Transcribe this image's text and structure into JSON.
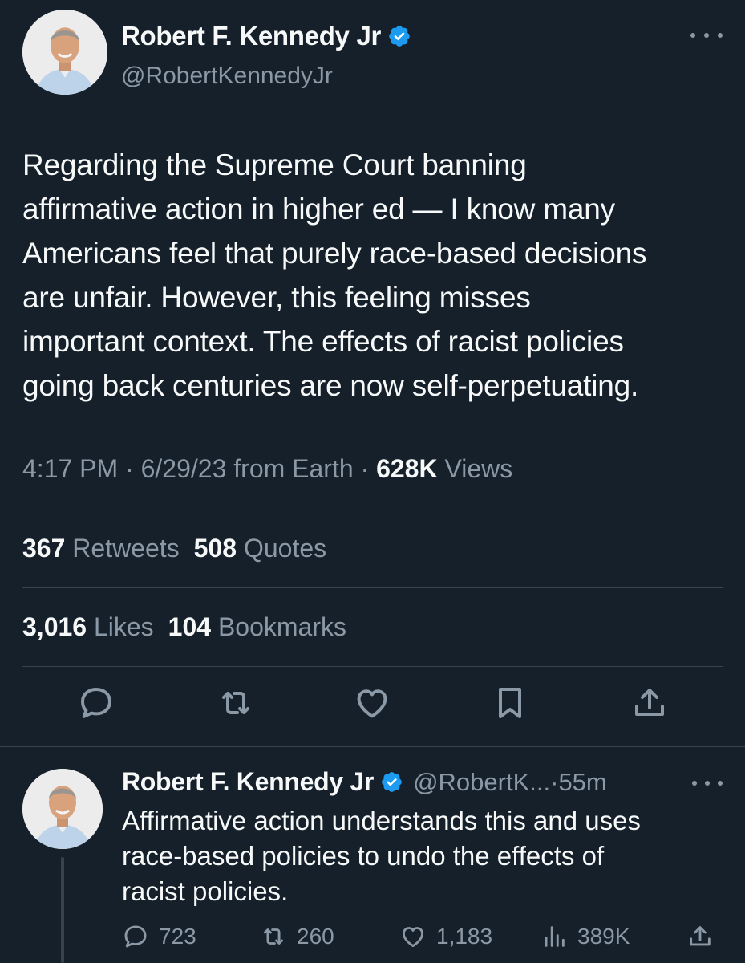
{
  "main_tweet": {
    "author": {
      "name": "Robert F. Kennedy Jr",
      "handle": "@RobertKennedyJr",
      "verified": true
    },
    "text_lines": [
      "Regarding the Supreme Court banning",
      "affirmative action in higher ed — I know many",
      "Americans feel that purely race-based decisions",
      "are unfair. However, this feeling misses",
      "important context. The effects of racist policies",
      "going back centuries are now self-perpetuating."
    ],
    "meta": {
      "time": "4:17 PM",
      "sep1": "·",
      "date_source": "6/29/23 from Earth",
      "sep2": "·",
      "views_count": "628K",
      "views_label": "Views"
    },
    "stats": {
      "retweets_count": "367",
      "retweets_label": "Retweets",
      "quotes_count": "508",
      "quotes_label": "Quotes",
      "likes_count": "3,016",
      "likes_label": "Likes",
      "bookmarks_count": "104",
      "bookmarks_label": "Bookmarks"
    },
    "actions": [
      "reply-icon",
      "retweet-icon",
      "like-icon",
      "bookmark-icon",
      "share-icon"
    ]
  },
  "reply_tweet": {
    "author": {
      "name": "Robert F. Kennedy Jr",
      "handle": "@RobertK...",
      "sep": "·",
      "time_ago": "55m",
      "verified": true
    },
    "text_lines": [
      "Affirmative action understands this and uses",
      "race-based policies to undo the effects of",
      "racist policies."
    ],
    "actions": {
      "replies": "723",
      "retweets": "260",
      "likes": "1,183",
      "views": "389K"
    }
  },
  "colors": {
    "background": "#15202b",
    "primary_text": "#f7f9f9",
    "secondary_text": "#8b98a5",
    "divider": "#38444d",
    "verified_badge": "#1d9bf0"
  }
}
